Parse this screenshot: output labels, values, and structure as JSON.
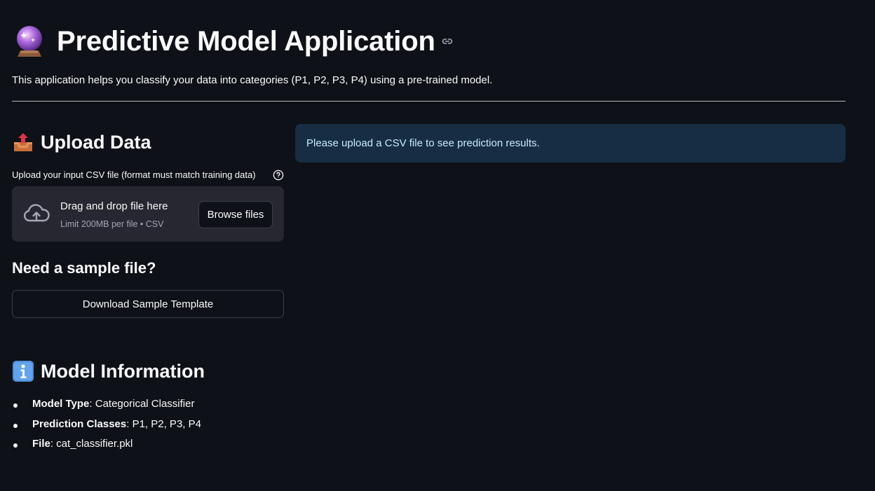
{
  "header": {
    "title": "Predictive Model Application",
    "title_icon": "crystal-ball-icon",
    "subtitle": "This application helps you classify your data into categories (P1, P2, P3, P4) using a pre-trained model."
  },
  "upload": {
    "heading": "Upload Data",
    "heading_icon": "outbox-tray-icon",
    "label": "Upload your input CSV file (format must match training data)",
    "dropzone_title": "Drag and drop file here",
    "dropzone_limit": "Limit 200MB per file • CSV",
    "browse_label": "Browse files"
  },
  "sample": {
    "heading": "Need a sample file?",
    "download_label": "Download Sample Template"
  },
  "model_info": {
    "heading": "Model Information",
    "heading_icon": "info-icon",
    "items": [
      {
        "key": "Model Type",
        "value": ": Categorical Classifier"
      },
      {
        "key": "Prediction Classes",
        "value": ": P1, P2, P3, P4"
      },
      {
        "key": "File",
        "value": ": cat_classifier.pkl"
      }
    ]
  },
  "alert": {
    "text": "Please upload a CSV file to see prediction results."
  },
  "colors": {
    "background": "#0e1117",
    "panel": "#262730",
    "info_box": "#172d43",
    "info_text": "#c7ebff"
  }
}
